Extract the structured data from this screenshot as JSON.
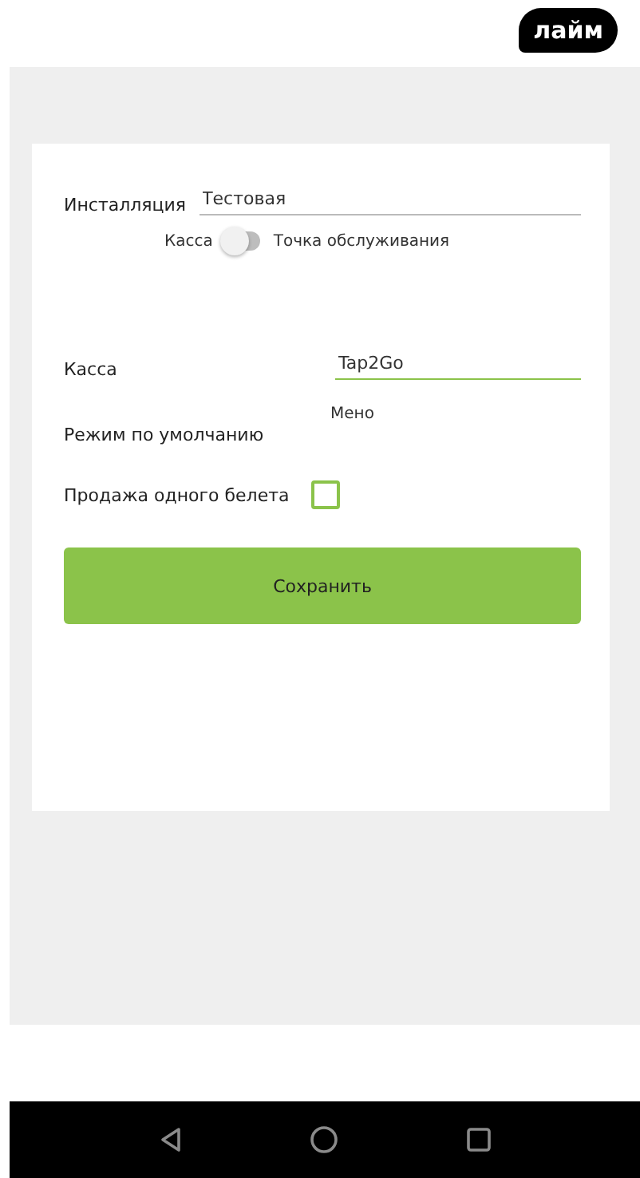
{
  "logo": {
    "text": "лайм"
  },
  "installation": {
    "label": "Инсталляция",
    "value": "Тестовая",
    "focused": false
  },
  "mode_switch": {
    "left_label": "Касса",
    "right_label": "Точка обслуживания",
    "on": false
  },
  "cash_register": {
    "label": "Касса",
    "value": "Tap2Go",
    "focused": true
  },
  "default_mode": {
    "label": "Режим по умолчанию",
    "value": "Мено"
  },
  "single_ticket": {
    "label": "Продажа одного белета",
    "checked": false
  },
  "save_button": {
    "label": "Сохранить"
  }
}
